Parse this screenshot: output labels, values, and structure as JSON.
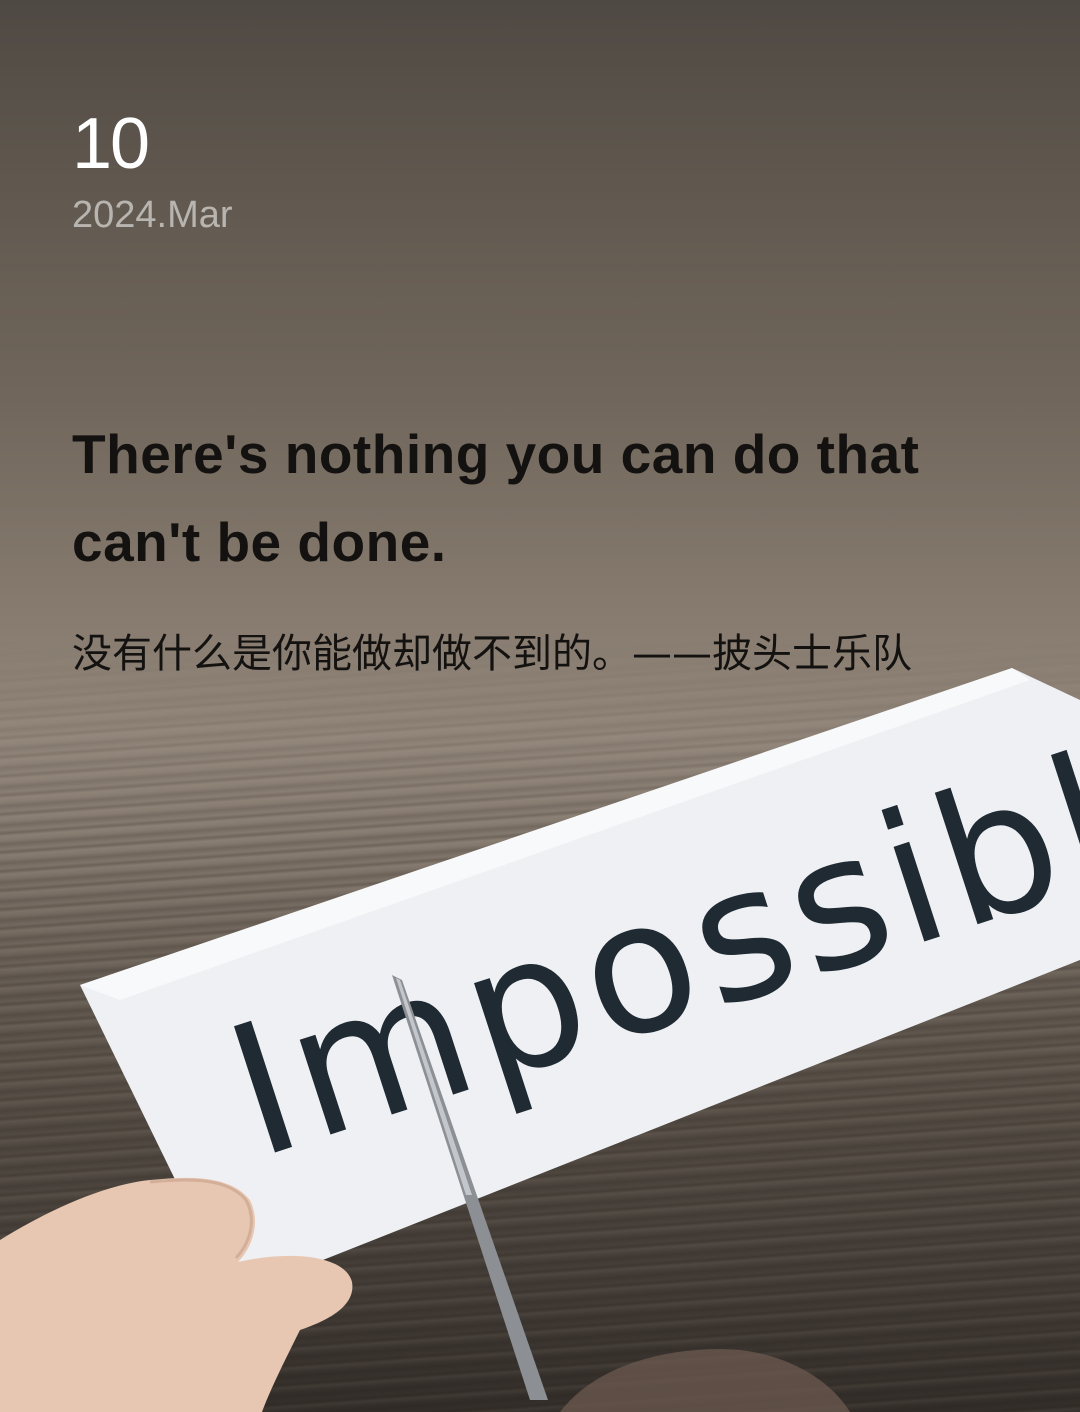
{
  "date": {
    "day": "10",
    "year_month": "2024.Mar"
  },
  "quote": {
    "english": "There's nothing you can do that can't be done.",
    "chinese": "没有什么是你能做却做不到的。——披头士乐队"
  },
  "photo": {
    "paper_text": "Impossible"
  },
  "colors": {
    "top_background": "#4f4943",
    "mid_background": "#93877b",
    "quote_text": "#141210",
    "paper": "#eef0f2",
    "ink": "#1f2a33"
  }
}
